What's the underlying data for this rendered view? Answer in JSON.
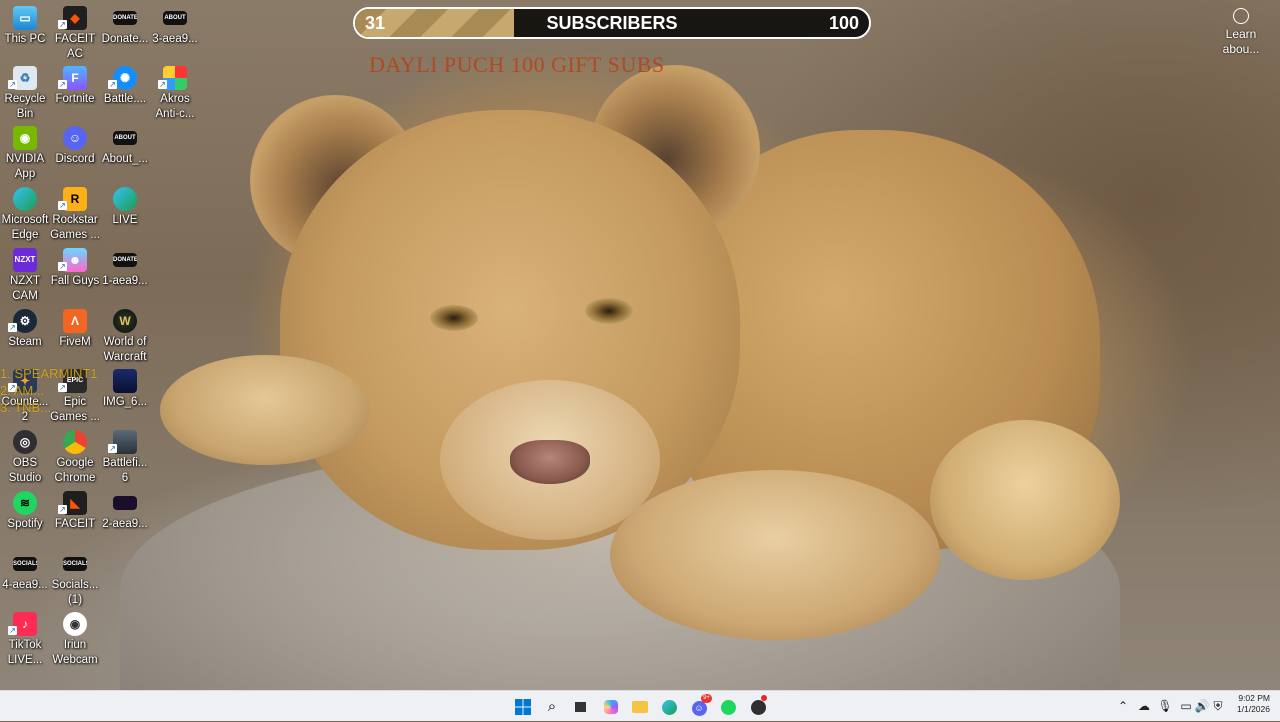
{
  "goal": {
    "current": "31",
    "title": "SUBSCRIBERS",
    "max": "100",
    "progress_fraction": 0.31
  },
  "gift_text": "DAYLI  PUCH 100 GIFT SUBS",
  "overlay_list": [
    "1.  SPEARMINT1",
    "2.  AM...",
    "3.  TNB..."
  ],
  "learn_about": {
    "label_1": "Learn",
    "label_2": "abou..."
  },
  "desktop_icons": {
    "this_pc": {
      "l1": "This PC",
      "l2": ""
    },
    "faceit_ac": {
      "l1": "FACEIT",
      "l2": "AC"
    },
    "donate": {
      "l1": "Donate...",
      "l2": ""
    },
    "aea9_3": {
      "l1": "3-aea9...",
      "l2": ""
    },
    "recycle_bin": {
      "l1": "Recycle",
      "l2": "Bin"
    },
    "fortnite": {
      "l1": "Fortnite",
      "l2": ""
    },
    "battlenet": {
      "l1": "Battle....",
      "l2": ""
    },
    "akros": {
      "l1": "Akros",
      "l2": "Anti-c..."
    },
    "nvidia": {
      "l1": "NVIDIA",
      "l2": "App"
    },
    "discord": {
      "l1": "Discord",
      "l2": ""
    },
    "about": {
      "l1": "About_...",
      "l2": ""
    },
    "edge": {
      "l1": "Microsoft",
      "l2": "Edge"
    },
    "rockstar": {
      "l1": "Rockstar",
      "l2": "Games ..."
    },
    "live": {
      "l1": "LIVE",
      "l2": ""
    },
    "nzxt": {
      "l1": "NZXT",
      "l2": "CAM"
    },
    "fallguys": {
      "l1": "Fall Guys",
      "l2": ""
    },
    "aea9_1": {
      "l1": "1-aea9...",
      "l2": ""
    },
    "steam": {
      "l1": "Steam",
      "l2": ""
    },
    "fivem": {
      "l1": "FiveM",
      "l2": ""
    },
    "wow": {
      "l1": "World of",
      "l2": "Warcraft"
    },
    "counter": {
      "l1": "Counte...",
      "l2": "2"
    },
    "epic": {
      "l1": "Epic",
      "l2": "Games ..."
    },
    "img6": {
      "l1": "IMG_6...",
      "l2": ""
    },
    "obs": {
      "l1": "OBS",
      "l2": "Studio"
    },
    "chrome": {
      "l1": "Google",
      "l2": "Chrome"
    },
    "bf6": {
      "l1": "Battlefi...",
      "l2": "6"
    },
    "spotify": {
      "l1": "Spotify",
      "l2": ""
    },
    "faceit": {
      "l1": "FACEIT",
      "l2": ""
    },
    "aea9_2": {
      "l1": "2-aea9...",
      "l2": ""
    },
    "aea9_4": {
      "l1": "4-aea9...",
      "l2": ""
    },
    "socials1": {
      "l1": "Socials...",
      "l2": "(1)"
    },
    "tiktok": {
      "l1": "TikTok",
      "l2": "LIVE..."
    },
    "iriun": {
      "l1": "Iriun",
      "l2": "Webcam"
    }
  },
  "clock": {
    "time": "9:02 PM",
    "date": "1/1/2026"
  },
  "discord_badge": "9+",
  "colors": {
    "goal_bg": "#000000",
    "goal_fill": "#b8996a",
    "gift_text": "#b5451b",
    "overlay_list": "#e0b21a",
    "taskbar": "#eef0f4"
  }
}
